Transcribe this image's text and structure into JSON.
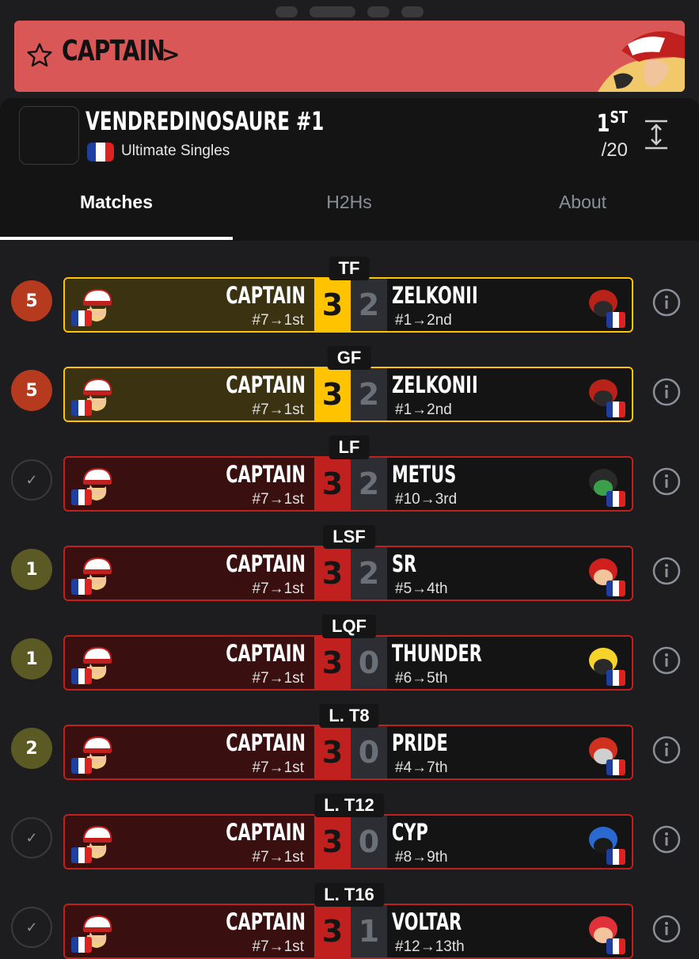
{
  "banner": {
    "player": "CAPTAIN",
    "chevron": ">",
    "color": "#d95757"
  },
  "tournament": {
    "name": "VENDREDINOSAURE #1",
    "event": "Ultimate Singles",
    "placement": "1",
    "placement_suffix": "ST",
    "total": "/20"
  },
  "tabs": [
    "Matches",
    "H2Hs",
    "About"
  ],
  "active_tab": "Matches",
  "colors": {
    "win_gold": "#ffc300",
    "win_gold_bg": "#3a3210",
    "loss_red": "#c0201e",
    "loss_red_bg": "#3a0f0f",
    "badge_red": "#b63a1e",
    "badge_olive": "#5c5a24"
  },
  "matches": [
    {
      "round": "TF",
      "badge": "5",
      "badge_type": "red",
      "style": "gold",
      "p1": "CAPTAIN",
      "p1_seed": "#7→1st",
      "s1": "3",
      "s2": "2",
      "p2": "ZELKONII",
      "p2_seed": "#1→2nd",
      "p2_icon": "incineroar-icon"
    },
    {
      "round": "GF",
      "badge": "5",
      "badge_type": "red",
      "style": "gold",
      "p1": "CAPTAIN",
      "p1_seed": "#7→1st",
      "s1": "3",
      "s2": "2",
      "p2": "ZELKONII",
      "p2_seed": "#1→2nd",
      "p2_icon": "incineroar-icon"
    },
    {
      "round": "LF",
      "badge": "✓",
      "badge_type": "check",
      "style": "red",
      "p1": "CAPTAIN",
      "p1_seed": "#7→1st",
      "s1": "3",
      "s2": "2",
      "p2": "METUS",
      "p2_seed": "#10→3rd",
      "p2_icon": "little-mac-icon"
    },
    {
      "round": "LSF",
      "badge": "1",
      "badge_type": "olive",
      "style": "red",
      "p1": "CAPTAIN",
      "p1_seed": "#7→1st",
      "s1": "3",
      "s2": "2",
      "p2": "SR",
      "p2_seed": "#5→4th",
      "p2_icon": "roy-icon"
    },
    {
      "round": "LQF",
      "badge": "1",
      "badge_type": "olive",
      "style": "red",
      "p1": "CAPTAIN",
      "p1_seed": "#7→1st",
      "s1": "3",
      "s2": "0",
      "p2": "THUNDER",
      "p2_seed": "#6→5th",
      "p2_icon": "pikachu-icon"
    },
    {
      "round": "L. T8",
      "badge": "2",
      "badge_type": "olive",
      "style": "red",
      "p1": "CAPTAIN",
      "p1_seed": "#7→1st",
      "s1": "3",
      "s2": "0",
      "p2": "PRIDE",
      "p2_seed": "#4→7th",
      "p2_icon": "samus-icon"
    },
    {
      "round": "L. T12",
      "badge": "✓",
      "badge_type": "check",
      "style": "red",
      "p1": "CAPTAIN",
      "p1_seed": "#7→1st",
      "s1": "3",
      "s2": "0",
      "p2": "CYP",
      "p2_seed": "#8→9th",
      "p2_icon": "lucario-icon"
    },
    {
      "round": "L. T16",
      "badge": "✓",
      "badge_type": "check",
      "style": "red",
      "p1": "CAPTAIN",
      "p1_seed": "#7→1st",
      "s1": "3",
      "s2": "1",
      "p2": "VOLTAR",
      "p2_seed": "#12→13th",
      "p2_icon": "pyra-icon"
    }
  ]
}
